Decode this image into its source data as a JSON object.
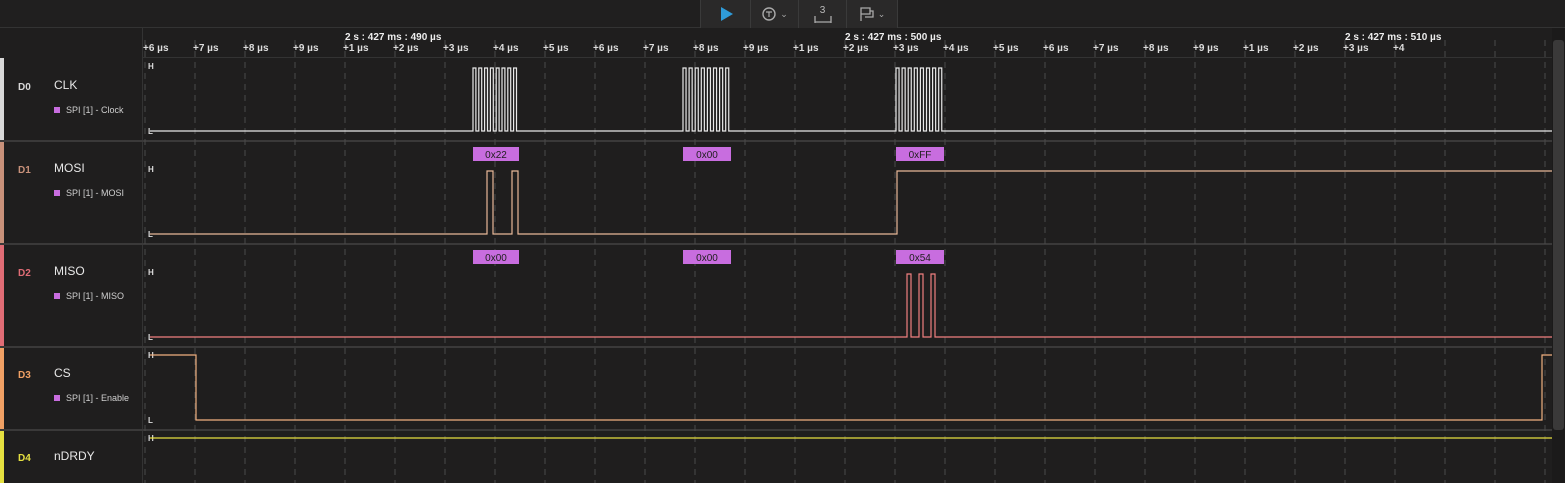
{
  "toolbar": {
    "play_icon": "play-icon",
    "trigger_icon": "trigger-settings-icon",
    "measure_label": "3",
    "measure_icon": "measure-icon",
    "marker_icon": "marker-icon"
  },
  "colors": {
    "D0": "#d8d8d8",
    "D1": "#c8917a",
    "D2": "#e06c75",
    "D3": "#f0a064",
    "D4": "#e5e040",
    "decode": "#c86ddf",
    "clk_wave": "#e8e8e8",
    "mosi_wave": "#e8b898",
    "miso_wave": "#f08080",
    "cs_wave": "#f0b080",
    "ndrdy_wave": "#e8e040"
  },
  "ruler": {
    "major_labels": [
      "2 s : 427 ms : 490 µs",
      "2 s : 427 ms : 500 µs",
      "2 s : 427 ms : 510 µs"
    ],
    "ticks": [
      "+6 µs",
      "+7 µs",
      "+8 µs",
      "+9 µs",
      "+1 µs",
      "+2 µs",
      "+3 µs",
      "+4 µs",
      "+5 µs",
      "+6 µs",
      "+7 µs",
      "+8 µs",
      "+9 µs",
      "+1 µs",
      "+2 µs",
      "+3 µs",
      "+4 µs",
      "+5 µs",
      "+6 µs",
      "+7 µs",
      "+8 µs",
      "+9 µs",
      "+1 µs",
      "+2 µs",
      "+3 µs",
      "+4"
    ]
  },
  "channels": [
    {
      "id": "D0",
      "name": "CLK",
      "analyzer": "SPI [1] - Clock",
      "high": "H",
      "low": "L"
    },
    {
      "id": "D1",
      "name": "MOSI",
      "analyzer": "SPI [1] - MOSI",
      "high": "H",
      "low": "L",
      "decodes": [
        "0x22",
        "0x00",
        "0xFF"
      ]
    },
    {
      "id": "D2",
      "name": "MISO",
      "analyzer": "SPI [1] - MISO",
      "high": "H",
      "low": "L",
      "decodes": [
        "0x00",
        "0x00",
        "0x54"
      ]
    },
    {
      "id": "D3",
      "name": "CS",
      "analyzer": "SPI [1] - Enable",
      "high": "H",
      "low": "L"
    },
    {
      "id": "D4",
      "name": "nDRDY",
      "high": "H"
    }
  ]
}
